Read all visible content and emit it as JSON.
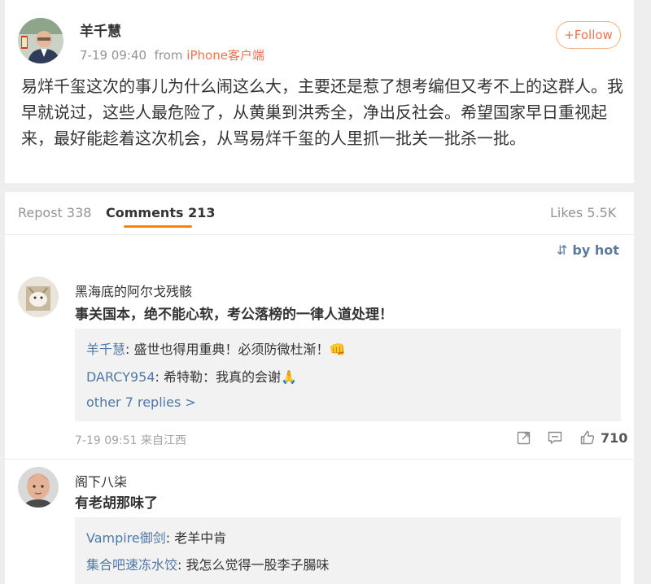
{
  "post": {
    "author": "羊千慧",
    "time": "7-19 09:40",
    "from_prefix": "from",
    "source": "iPhone客户端",
    "follow_label": "+Follow",
    "text": "易烊千玺这次的事儿为什么闹这么大，主要还是惹了想考编但又考不上的这群人。我早就说过，这些人最危险了，从黄巢到洪秀全，净出反社会。希望国家早日重视起来，最好能趁着这次机会，从骂易烊千玺的人里抓一批关一批杀一批。"
  },
  "tabs": {
    "repost": "Repost 338",
    "comments": "Comments 213",
    "likes": "Likes 5.5K"
  },
  "sort_label": "by hot",
  "comments": [
    {
      "name": "黑海底的阿尔戈残骸",
      "text": "事关国本，绝不能心软，考公落榜的一律人道处理！",
      "replies": [
        {
          "user": "羊千慧",
          "sep": ":",
          "text": " 盛世也得用重典！必须防微杜渐！👊"
        },
        {
          "user": "DARCY954",
          "sep": ":",
          "text": " 希特勒：我真的会谢🙏"
        }
      ],
      "more": "other 7 replies >",
      "time": "7-19 09:51",
      "location": "来自江西",
      "likes": "710"
    },
    {
      "name": "阁下八柒",
      "text": "有老胡那味了",
      "replies": [
        {
          "user": "Vampire御剑",
          "sep": ":",
          "text": " 老羊中肯"
        },
        {
          "user": "集合吧速冻水饺",
          "sep": ":",
          "text": " 我怎么觉得一股李子腸味"
        }
      ]
    }
  ],
  "colors": {
    "accent": "#eb7350",
    "link": "#4f78a6",
    "tab_underline": "#ff8200"
  }
}
